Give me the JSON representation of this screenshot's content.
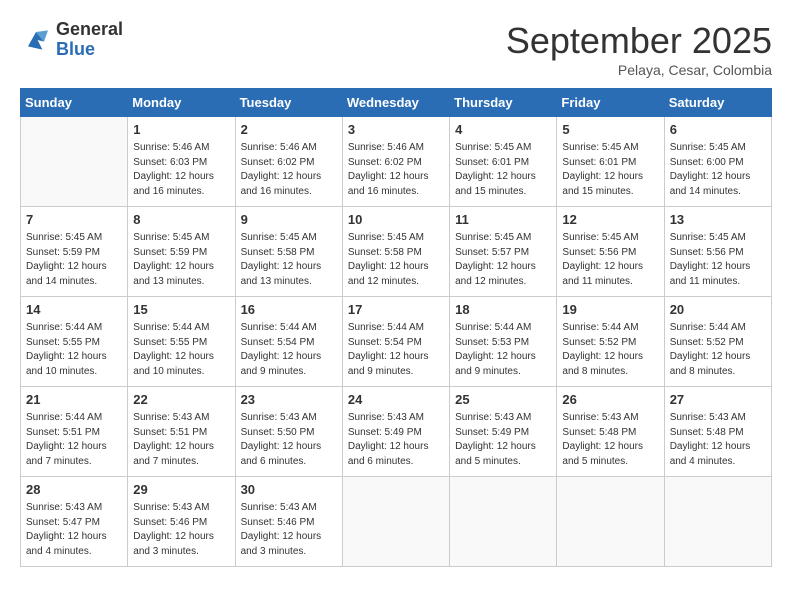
{
  "header": {
    "logo_general": "General",
    "logo_blue": "Blue",
    "month_title": "September 2025",
    "location": "Pelaya, Cesar, Colombia"
  },
  "weekdays": [
    "Sunday",
    "Monday",
    "Tuesday",
    "Wednesday",
    "Thursday",
    "Friday",
    "Saturday"
  ],
  "weeks": [
    [
      {
        "day": "",
        "info": ""
      },
      {
        "day": "1",
        "info": "Sunrise: 5:46 AM\nSunset: 6:03 PM\nDaylight: 12 hours\nand 16 minutes."
      },
      {
        "day": "2",
        "info": "Sunrise: 5:46 AM\nSunset: 6:02 PM\nDaylight: 12 hours\nand 16 minutes."
      },
      {
        "day": "3",
        "info": "Sunrise: 5:46 AM\nSunset: 6:02 PM\nDaylight: 12 hours\nand 16 minutes."
      },
      {
        "day": "4",
        "info": "Sunrise: 5:45 AM\nSunset: 6:01 PM\nDaylight: 12 hours\nand 15 minutes."
      },
      {
        "day": "5",
        "info": "Sunrise: 5:45 AM\nSunset: 6:01 PM\nDaylight: 12 hours\nand 15 minutes."
      },
      {
        "day": "6",
        "info": "Sunrise: 5:45 AM\nSunset: 6:00 PM\nDaylight: 12 hours\nand 14 minutes."
      }
    ],
    [
      {
        "day": "7",
        "info": "Sunrise: 5:45 AM\nSunset: 5:59 PM\nDaylight: 12 hours\nand 14 minutes."
      },
      {
        "day": "8",
        "info": "Sunrise: 5:45 AM\nSunset: 5:59 PM\nDaylight: 12 hours\nand 13 minutes."
      },
      {
        "day": "9",
        "info": "Sunrise: 5:45 AM\nSunset: 5:58 PM\nDaylight: 12 hours\nand 13 minutes."
      },
      {
        "day": "10",
        "info": "Sunrise: 5:45 AM\nSunset: 5:58 PM\nDaylight: 12 hours\nand 12 minutes."
      },
      {
        "day": "11",
        "info": "Sunrise: 5:45 AM\nSunset: 5:57 PM\nDaylight: 12 hours\nand 12 minutes."
      },
      {
        "day": "12",
        "info": "Sunrise: 5:45 AM\nSunset: 5:56 PM\nDaylight: 12 hours\nand 11 minutes."
      },
      {
        "day": "13",
        "info": "Sunrise: 5:45 AM\nSunset: 5:56 PM\nDaylight: 12 hours\nand 11 minutes."
      }
    ],
    [
      {
        "day": "14",
        "info": "Sunrise: 5:44 AM\nSunset: 5:55 PM\nDaylight: 12 hours\nand 10 minutes."
      },
      {
        "day": "15",
        "info": "Sunrise: 5:44 AM\nSunset: 5:55 PM\nDaylight: 12 hours\nand 10 minutes."
      },
      {
        "day": "16",
        "info": "Sunrise: 5:44 AM\nSunset: 5:54 PM\nDaylight: 12 hours\nand 9 minutes."
      },
      {
        "day": "17",
        "info": "Sunrise: 5:44 AM\nSunset: 5:54 PM\nDaylight: 12 hours\nand 9 minutes."
      },
      {
        "day": "18",
        "info": "Sunrise: 5:44 AM\nSunset: 5:53 PM\nDaylight: 12 hours\nand 9 minutes."
      },
      {
        "day": "19",
        "info": "Sunrise: 5:44 AM\nSunset: 5:52 PM\nDaylight: 12 hours\nand 8 minutes."
      },
      {
        "day": "20",
        "info": "Sunrise: 5:44 AM\nSunset: 5:52 PM\nDaylight: 12 hours\nand 8 minutes."
      }
    ],
    [
      {
        "day": "21",
        "info": "Sunrise: 5:44 AM\nSunset: 5:51 PM\nDaylight: 12 hours\nand 7 minutes."
      },
      {
        "day": "22",
        "info": "Sunrise: 5:43 AM\nSunset: 5:51 PM\nDaylight: 12 hours\nand 7 minutes."
      },
      {
        "day": "23",
        "info": "Sunrise: 5:43 AM\nSunset: 5:50 PM\nDaylight: 12 hours\nand 6 minutes."
      },
      {
        "day": "24",
        "info": "Sunrise: 5:43 AM\nSunset: 5:49 PM\nDaylight: 12 hours\nand 6 minutes."
      },
      {
        "day": "25",
        "info": "Sunrise: 5:43 AM\nSunset: 5:49 PM\nDaylight: 12 hours\nand 5 minutes."
      },
      {
        "day": "26",
        "info": "Sunrise: 5:43 AM\nSunset: 5:48 PM\nDaylight: 12 hours\nand 5 minutes."
      },
      {
        "day": "27",
        "info": "Sunrise: 5:43 AM\nSunset: 5:48 PM\nDaylight: 12 hours\nand 4 minutes."
      }
    ],
    [
      {
        "day": "28",
        "info": "Sunrise: 5:43 AM\nSunset: 5:47 PM\nDaylight: 12 hours\nand 4 minutes."
      },
      {
        "day": "29",
        "info": "Sunrise: 5:43 AM\nSunset: 5:46 PM\nDaylight: 12 hours\nand 3 minutes."
      },
      {
        "day": "30",
        "info": "Sunrise: 5:43 AM\nSunset: 5:46 PM\nDaylight: 12 hours\nand 3 minutes."
      },
      {
        "day": "",
        "info": ""
      },
      {
        "day": "",
        "info": ""
      },
      {
        "day": "",
        "info": ""
      },
      {
        "day": "",
        "info": ""
      }
    ]
  ]
}
